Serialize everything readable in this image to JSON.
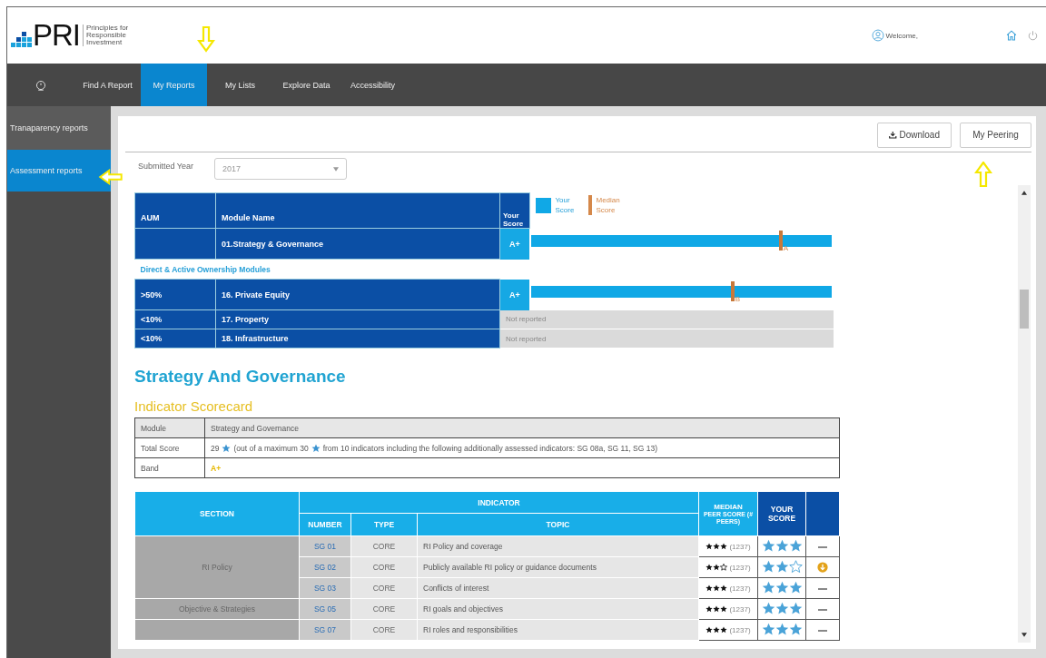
{
  "header": {
    "logo": {
      "mark": "PRI",
      "tagline": [
        "Principles for",
        "Responsible",
        "Investment"
      ]
    },
    "welcome": "Welcome,"
  },
  "nav": [
    {
      "label": "Find A Report",
      "selected": false
    },
    {
      "label": "My Reports",
      "selected": true
    },
    {
      "label": "My Lists",
      "selected": false
    },
    {
      "label": "Explore Data",
      "selected": false
    },
    {
      "label": "Accessibility",
      "selected": false
    }
  ],
  "sidebar": {
    "items": [
      {
        "label": "Tranaparency reports",
        "selected": false
      },
      {
        "label": "Assessment reports",
        "selected": true
      }
    ]
  },
  "toolbar": {
    "buttons": [
      {
        "label": "Download",
        "kind": "download"
      },
      {
        "label": "My Peering",
        "kind": "plain"
      }
    ]
  },
  "filter": {
    "label": "Submitted Year",
    "value": "2017"
  },
  "module_table": {
    "columns": [
      "AUM",
      "Module Name",
      "Your Score"
    ],
    "legend": [
      {
        "label": "Your Score",
        "kind": "bar"
      },
      {
        "label": "Median Score",
        "kind": "median"
      }
    ],
    "rows": [
      {
        "kind": "module",
        "module": "01.Strategy & Governance",
        "score": "A+",
        "level": 1,
        "median": {
          "label": "A",
          "level": 0.83
        }
      },
      {
        "kind": "group",
        "label": "Direct & Active Ownership Modules"
      },
      {
        "kind": "module",
        "aum": ">50%",
        "module": "16. Private Equity",
        "score": "A+",
        "level": 1,
        "median": {
          "label": "B",
          "level": 0.67
        }
      },
      {
        "kind": "not_reported",
        "aum": "<10%",
        "module": "17. Property",
        "note": "Not reported"
      },
      {
        "kind": "not_reported",
        "aum": "<10%",
        "module": "18. Infrastructure",
        "note": "Not reported"
      }
    ]
  },
  "section_title": "Strategy And Governance",
  "scorecard": {
    "title": "Indicator Scorecard",
    "rows": [
      {
        "kind": "head",
        "label": "Module",
        "value": "Strategy and Governance"
      },
      {
        "kind": "score",
        "label": "Total Score",
        "segments": [
          "29",
          "(out of a maximum 30",
          "from 10 indicators including the following additionally assessed indicators: SG 08a, SG 11, SG 13)"
        ]
      },
      {
        "kind": "band",
        "label": "Band",
        "value": "A+"
      }
    ]
  },
  "indicator_table": {
    "header": {
      "section": "SECTION",
      "indicator": "INDICATOR",
      "number": "NUMBER",
      "type": "TYPE",
      "topic": "TOPIC",
      "median": "MEDIAN",
      "median_sub": "PEER SCORE (# PEERS)",
      "your_score": "YOUR SCORE"
    },
    "sections": [
      {
        "label": "RI Policy",
        "rows": [
          {
            "number": "SG 01",
            "type": "CORE",
            "topic": "RI Policy and coverage",
            "median": {
              "stars": 3,
              "count": "(1237)"
            },
            "score": {
              "stars": 3
            },
            "kind": "dash"
          },
          {
            "number": "SG 02",
            "type": "CORE",
            "topic": "Publicly available RI policy or guidance documents",
            "median": {
              "stars": 2,
              "count": "(1237)"
            },
            "score": {
              "stars": 2
            },
            "kind": "alert"
          },
          {
            "number": "SG 03",
            "type": "CORE",
            "topic": "Conflicts of interest",
            "median": {
              "stars": 3,
              "count": "(1237)"
            },
            "score": {
              "stars": 3
            },
            "kind": "dash"
          }
        ]
      },
      {
        "label": "Objective & Strategies",
        "rows": [
          {
            "number": "SG 05",
            "type": "CORE",
            "topic": "RI goals and objectives",
            "median": {
              "stars": 3,
              "count": "(1237)"
            },
            "score": {
              "stars": 3
            },
            "kind": "dash"
          }
        ]
      },
      {
        "rows": [
          {
            "number": "SG 07",
            "type": "CORE",
            "topic": "RI roles and responsibilities",
            "median": {
              "stars": 3,
              "count": "(1237)"
            },
            "score": {
              "stars": 3
            },
            "kind": "dash"
          }
        ]
      }
    ]
  }
}
